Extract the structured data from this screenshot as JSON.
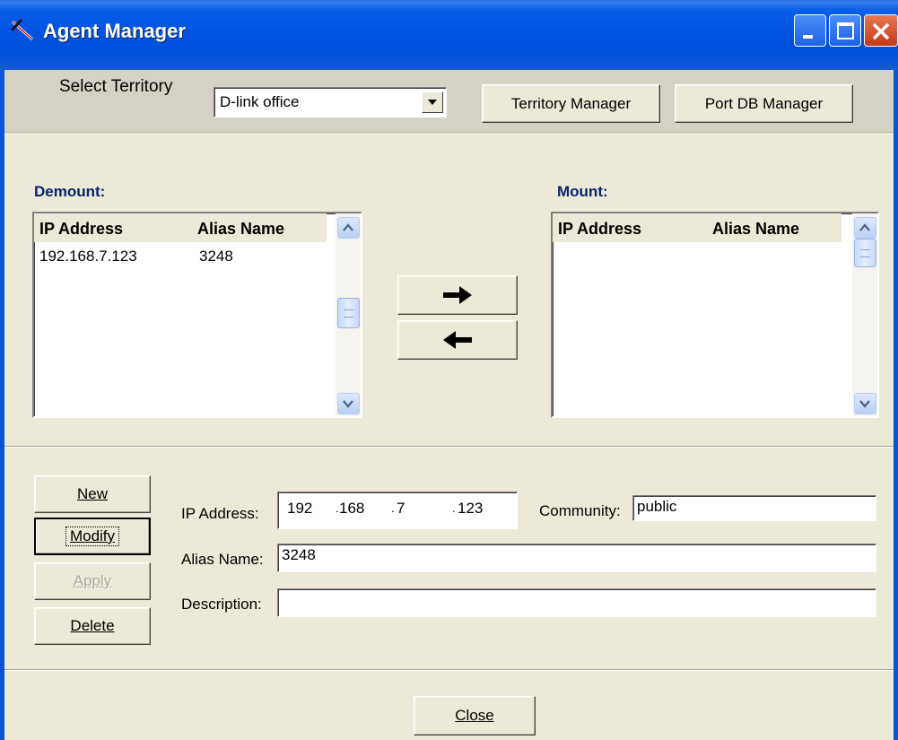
{
  "window": {
    "title": "Agent Manager"
  },
  "territory": {
    "label": "Select Territory",
    "selected": "D-link office",
    "territory_manager_label": "Territory Manager",
    "port_db_manager_label": "Port DB Manager"
  },
  "demount": {
    "label": "Demount:",
    "columns": [
      "IP Address",
      "Alias Name"
    ],
    "rows": [
      {
        "ip": "192.168.7.123",
        "alias": "3248"
      }
    ]
  },
  "mount": {
    "label": "Mount:",
    "columns": [
      "IP Address",
      "Alias Name"
    ],
    "rows": []
  },
  "transfer": {
    "mount_arrow": "→",
    "demount_arrow": "←"
  },
  "actions": {
    "new_label": "New",
    "modify_label": "Modify",
    "apply_label": "Apply",
    "delete_label": "Delete"
  },
  "form": {
    "ip_label": "IP Address:",
    "ip_octets": [
      "192",
      "168",
      "7",
      "123"
    ],
    "community_label": "Community:",
    "community_value": "public",
    "alias_label": "Alias Name:",
    "alias_value": "3248",
    "description_label": "Description:",
    "description_value": ""
  },
  "footer": {
    "close_label": "Close"
  },
  "colors": {
    "titlebar": "#0053e1",
    "group_label": "#0a246a",
    "face": "#ece9d8",
    "close_button": "#c23a18"
  }
}
